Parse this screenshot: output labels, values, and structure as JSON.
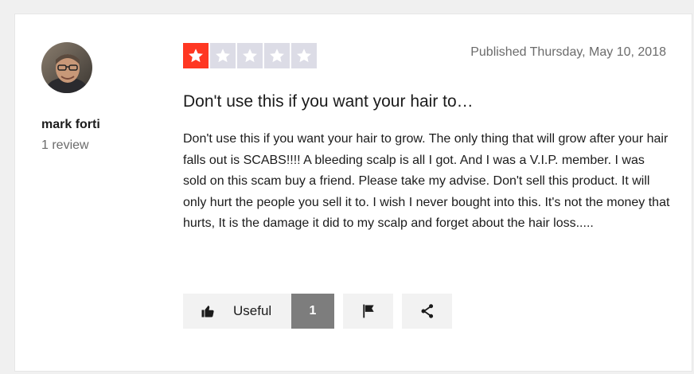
{
  "theme": {
    "accent": "#ff3722",
    "star_empty": "#dcdce6",
    "count_badge_bg": "#7d7d7d"
  },
  "reviewer": {
    "name": "mark forti",
    "review_count": "1 review",
    "avatar_icon": "user-photo"
  },
  "review": {
    "rating": 1,
    "max_rating": 5,
    "published": "Published Thursday, May 10, 2018",
    "title": "Don't use this if you want your hair to…",
    "body": "Don't use this if you want your hair to grow. The only thing that will grow after your hair falls out is SCABS!!!! A bleeding scalp is all I got. And I was a V.I.P. member. I was sold on this scam buy a friend. Please take my advise. Don't sell this product. It will only hurt the people you sell it to. I wish I never bought into this. It's not the money that hurts, It is the damage it did to my scalp and forget about the hair loss....."
  },
  "actions": {
    "useful_label": "Useful",
    "useful_count": "1",
    "useful_icon": "thumbs-up-icon",
    "flag_icon": "flag-icon",
    "share_icon": "share-icon"
  }
}
